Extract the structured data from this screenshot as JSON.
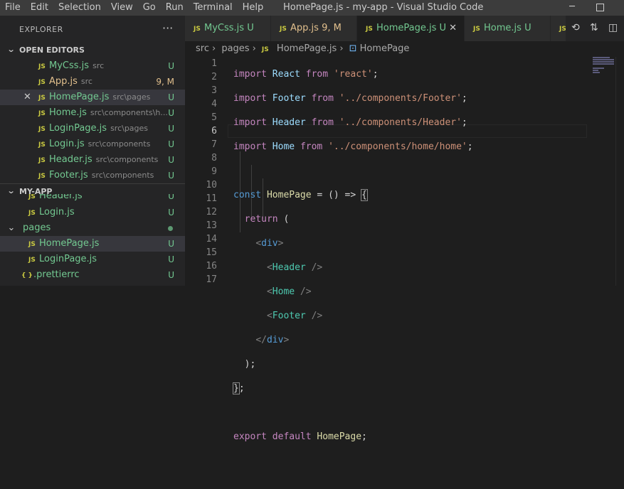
{
  "menu": [
    "File",
    "Edit",
    "Selection",
    "View",
    "Go",
    "Run",
    "Terminal",
    "Help"
  ],
  "window_title": "HomePage.js - my-app - Visual Studio Code",
  "window_controls": {
    "minimize": "─"
  },
  "sidebar": {
    "title": "EXPLORER",
    "more": "···",
    "open_editors_label": "OPEN EDITORS",
    "app_label": "MY-APP",
    "open_editors": [
      {
        "name": "MyCss.js",
        "path": "src",
        "badge": "U"
      },
      {
        "name": "App.js",
        "path": "src",
        "badge": "9, M"
      },
      {
        "name": "HomePage.js",
        "path": "src\\pages",
        "badge": "U"
      },
      {
        "name": "Home.js",
        "path": "src\\components\\h...",
        "badge": "U"
      },
      {
        "name": "LoginPage.js",
        "path": "src\\pages",
        "badge": "U"
      },
      {
        "name": "Login.js",
        "path": "src\\components",
        "badge": "U"
      },
      {
        "name": "Header.js",
        "path": "src\\components",
        "badge": "U"
      },
      {
        "name": "Footer.js",
        "path": "src\\components",
        "badge": "U"
      }
    ],
    "tree": [
      {
        "name": "Header.js",
        "badge": "U"
      },
      {
        "name": "Login.js",
        "badge": "U"
      },
      {
        "name": "pages"
      },
      {
        "name": "HomePage.js",
        "badge": "U"
      },
      {
        "name": "LoginPage.js",
        "badge": "U"
      },
      {
        "name": ".prettierrc",
        "badge": "U"
      }
    ]
  },
  "tabs": [
    {
      "name": "MyCss.js",
      "badge": "U"
    },
    {
      "name": "App.js",
      "badge": "9, M"
    },
    {
      "name": "HomePage.js",
      "badge": "U"
    },
    {
      "name": "Home.js",
      "badge": "U"
    },
    {
      "name": "JS"
    }
  ],
  "icons": {
    "js": "JS",
    "braces": "{ }",
    "close": "✕"
  },
  "breadcrumb": [
    "src",
    "pages",
    "HomePage.js",
    "HomePage"
  ],
  "line_numbers": [
    "1",
    "2",
    "3",
    "4",
    "5",
    "6",
    "7",
    "8",
    "9",
    "10",
    "11",
    "12",
    "13",
    "14",
    "15",
    "16",
    "17"
  ],
  "code": {
    "l1": [
      "import",
      "React",
      "from",
      "'react'",
      ";"
    ],
    "l2": [
      "import",
      "Footer",
      "from",
      "'../components/Footer'",
      ";"
    ],
    "l3": [
      "import",
      "Header",
      "from",
      "'../components/Header'",
      ";"
    ],
    "l4": [
      "import",
      "Home",
      "from",
      "'../components/home/home'",
      ";"
    ],
    "l6": [
      "const",
      "HomePage",
      "= () =>",
      "{"
    ],
    "l7": [
      "return",
      "("
    ],
    "l8": [
      "<",
      "div",
      ">"
    ],
    "l9": [
      "<",
      "Header",
      " />"
    ],
    "l10": [
      "<",
      "Home",
      " />"
    ],
    "l11": [
      "<",
      "Footer",
      " />"
    ],
    "l12": [
      "</",
      "div",
      ">"
    ],
    "l13": [
      ");"
    ],
    "l14": [
      "}",
      ";"
    ],
    "l16": [
      "export",
      "default",
      "HomePage",
      ";"
    ]
  },
  "colors": {
    "untracked": "#73c991",
    "modified": "#e2c08d",
    "keyword": "#c586c0",
    "string": "#ce9178"
  }
}
